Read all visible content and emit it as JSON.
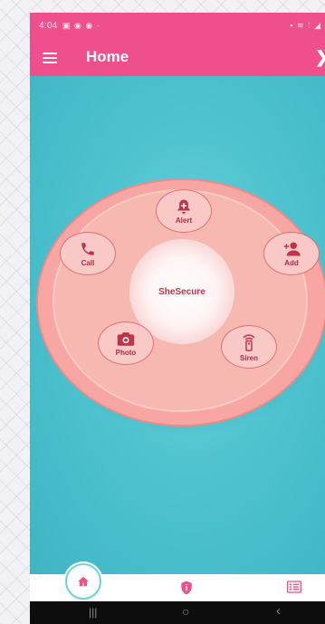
{
  "status_bar": {
    "time": "4:04",
    "left_icons": "▣ ◉ ◉ ·",
    "right_icons": "▪ ≋ ⁞ ◢"
  },
  "app_bar": {
    "title": "Home",
    "menu_icon": "hamburger-menu-icon",
    "right_icon": "share-icon"
  },
  "wheel": {
    "center_label": "SheSecure",
    "actions": [
      {
        "key": "alert",
        "label": "Alert",
        "icon": "bell-plus-icon"
      },
      {
        "key": "add",
        "label": "Add",
        "icon": "add-person-icon"
      },
      {
        "key": "siren",
        "label": "Siren",
        "icon": "siren-remote-icon"
      },
      {
        "key": "photo",
        "label": "Photo",
        "icon": "camera-icon"
      },
      {
        "key": "call",
        "label": "Call",
        "icon": "phone-icon"
      }
    ]
  },
  "bottom_nav": {
    "items": [
      {
        "name": "home",
        "icon": "home-icon",
        "active": true
      },
      {
        "name": "info",
        "icon": "info-shield-icon",
        "active": false
      },
      {
        "name": "list",
        "icon": "list-icon",
        "active": false
      }
    ]
  },
  "system_nav": {
    "recent": "|||",
    "home": "○",
    "back": "‹"
  },
  "colors": {
    "primary": "#ef4f8c",
    "background": "#4fc3cf",
    "wheel": "#f7a6a3",
    "accent_text": "#b02c44"
  }
}
